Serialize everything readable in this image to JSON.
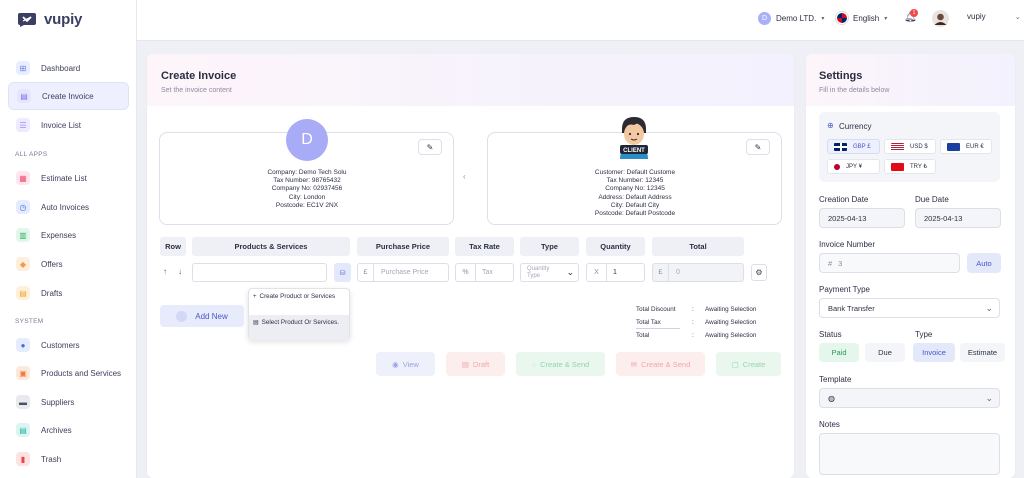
{
  "app": {
    "name": "vupiy"
  },
  "sidebar": {
    "items": [
      {
        "label": "Dashboard",
        "icon": "grid-icon",
        "color": "#5f7ef0"
      },
      {
        "label": "Create Invoice",
        "icon": "file-icon",
        "color": "#7b73e8"
      },
      {
        "label": "Invoice List",
        "icon": "list-icon",
        "color": "#9d8ef0"
      }
    ],
    "all_apps_label": "ALL APPS",
    "apps": [
      {
        "label": "Estimate List",
        "icon": "estimate-icon",
        "color": "#f0507a"
      },
      {
        "label": "Auto Invoices",
        "icon": "clock-icon",
        "color": "#3e6fe6"
      },
      {
        "label": "Expenses",
        "icon": "receipt-icon",
        "color": "#30b56b"
      },
      {
        "label": "Offers",
        "icon": "tag-icon",
        "color": "#f59a3d"
      },
      {
        "label": "Drafts",
        "icon": "draft-icon",
        "color": "#f4a72c"
      }
    ],
    "system_label": "SYSTEM",
    "system": [
      {
        "label": "Customers",
        "icon": "user-icon",
        "color": "#3e6fe6"
      },
      {
        "label": "Products and Services",
        "icon": "box-icon",
        "color": "#f07d3d"
      },
      {
        "label": "Suppliers",
        "icon": "truck-icon",
        "color": "#4a4f63"
      },
      {
        "label": "Archives",
        "icon": "archive-icon",
        "color": "#23b5a5"
      },
      {
        "label": "Trash",
        "icon": "trash-icon",
        "color": "#ef4444"
      }
    ]
  },
  "topbar": {
    "company": "Demo LTD.",
    "company_initial": "D",
    "language": "English",
    "notification_count": "1",
    "user": "vupiy"
  },
  "invoice": {
    "title": "Create Invoice",
    "subtitle": "Set the invoice content",
    "company": {
      "initial": "D",
      "lines": [
        "Company: Demo Tech Solu",
        "Tax Number: 98765432",
        "Company No: 02937456",
        "City: London",
        "Postcode: EC1V 2NX"
      ]
    },
    "customer": {
      "badge": "CLIENT",
      "lines": [
        "Customer: Default Custome",
        "Tax Number: 12345",
        "Company No: 12345",
        "Address: Default Address",
        "City: Default City",
        "Postcode: Default Postcode"
      ]
    },
    "table": {
      "headers": [
        "Row",
        "Products & Services",
        "Purchase Price",
        "Tax Rate",
        "Type",
        "Quantity",
        "Total"
      ],
      "row": {
        "price_prefix": "£",
        "price_placeholder": "Purchase Price",
        "tax_prefix": "%",
        "tax_placeholder": "Tax",
        "type_placeholder": "Quantity Type",
        "qty_prefix": "X",
        "qty_value": "1",
        "total_prefix": "£",
        "total_value": "0"
      }
    },
    "dropdown": {
      "create": "Create Product or Services",
      "select": "Select Product Or Services."
    },
    "add_new": "Add New",
    "totals": [
      {
        "label": "Total Discount",
        "value": "Awaiting Selection"
      },
      {
        "label": "Total Tax",
        "value": "Awaiting Selection"
      },
      {
        "label": "Total",
        "value": "Awaiting Selection"
      }
    ],
    "actions": {
      "view": "View",
      "draft": "Draft",
      "create_send_1": "Create & Send",
      "create_send_2": "Create & Send",
      "create": "Create"
    }
  },
  "settings": {
    "title": "Settings",
    "subtitle": "Fill in the details below",
    "currency_label": "Currency",
    "currencies": [
      {
        "label": "GBP £",
        "active": true
      },
      {
        "label": "USD $",
        "active": false
      },
      {
        "label": "EUR €",
        "active": false
      },
      {
        "label": "JPY ¥",
        "active": false
      },
      {
        "label": "TRY ₺",
        "active": false
      }
    ],
    "creation_date_label": "Creation Date",
    "creation_date": "2025-04-13",
    "due_date_label": "Due Date",
    "due_date": "2025-04-13",
    "invoice_number_label": "Invoice Number",
    "invoice_prefix": "#",
    "invoice_number": "3",
    "auto_label": "Auto",
    "payment_type_label": "Payment Type",
    "payment_type": "Bank Transfer",
    "status_label": "Status",
    "status_options": [
      "Paid",
      "Due"
    ],
    "type_label": "Type",
    "type_options": [
      "Invoice",
      "Estimate"
    ],
    "template_label": "Template",
    "notes_label": "Notes"
  }
}
